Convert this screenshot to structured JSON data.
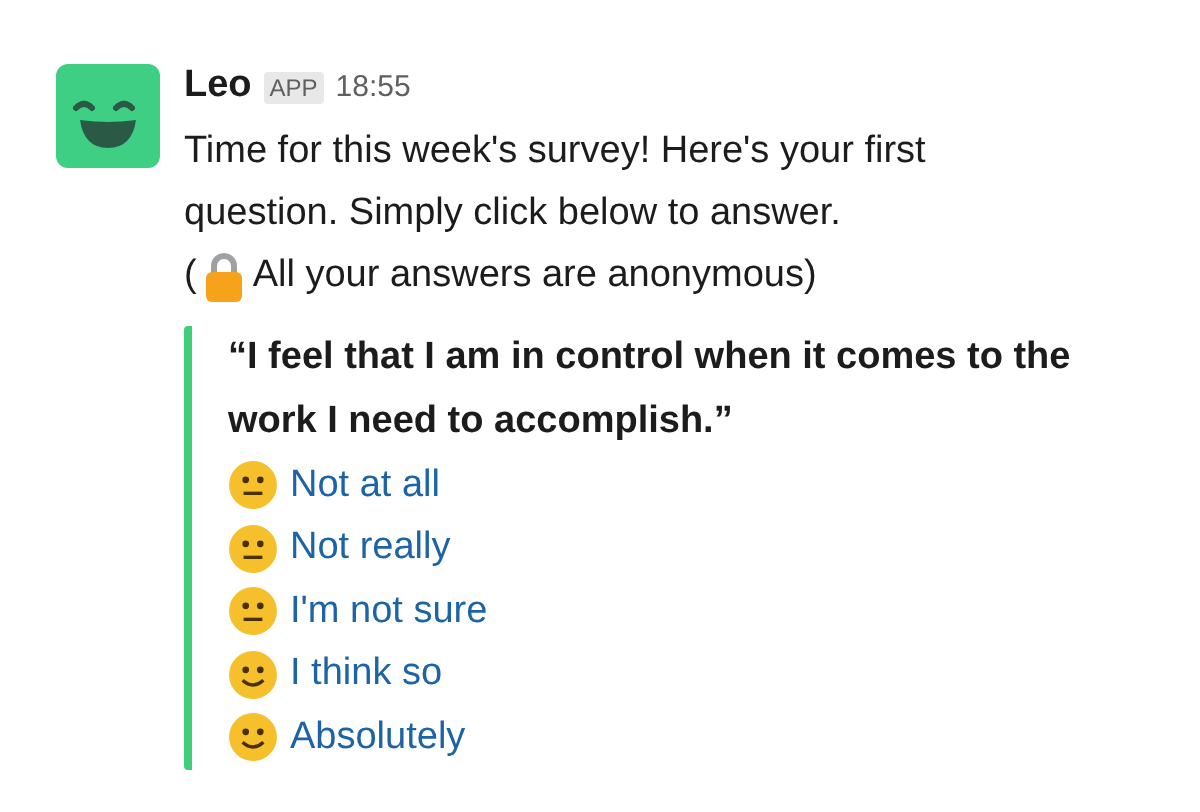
{
  "message": {
    "sender": "Leo",
    "badge": "APP",
    "time": "18:55",
    "text": [
      "Time for this week's survey! Here's your first",
      "question. Simply click below to answer."
    ],
    "note": {
      "open": "(",
      "text": "All your answers are anonymous)"
    }
  },
  "attachment": {
    "question": "“I feel that I am in control when it comes to the work I need to accomplish.”",
    "options": [
      {
        "kind": "neutral",
        "label": "Not at all"
      },
      {
        "kind": "neutral",
        "label": "Not really"
      },
      {
        "kind": "neutral",
        "label": "I'm not sure"
      },
      {
        "kind": "smile",
        "label": "I think so"
      },
      {
        "kind": "smile",
        "label": "Absolutely"
      }
    ]
  }
}
